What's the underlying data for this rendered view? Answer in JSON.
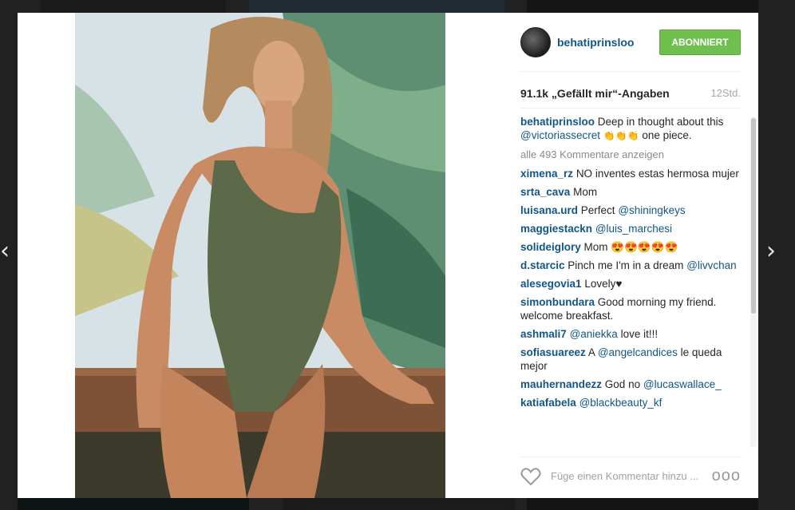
{
  "modal": {
    "username": "behatiprinsloo",
    "follow_label": "ABONNIERT",
    "likes": "91.1k „Gefällt mir“-Angaben",
    "time": "12Std.",
    "caption": {
      "user": "behatiprinsloo",
      "text_before": "Deep in thought about this",
      "mention": "@victoriassecret",
      "emoji": "👏👏👏",
      "text_after": "one piece."
    },
    "load_more": "alle 493 Kommentare anzeigen",
    "comments": [
      {
        "user": "ximena_rz",
        "text": "NO inventes estas hermosa mujer",
        "mention": ""
      },
      {
        "user": "srta_cava",
        "text": "Mom",
        "mention": ""
      },
      {
        "user": "luisana.urd",
        "text": "Perfect",
        "mention": "@shiningkeys"
      },
      {
        "user": "maggiestackn",
        "text": "",
        "mention": "@luis_marchesi"
      },
      {
        "user": "solideiglory",
        "text": "Mom 😍😍😍😍😍",
        "mention": ""
      },
      {
        "user": "d.starcic",
        "text": "Pinch me I'm in a dream",
        "mention": "@livvchan"
      },
      {
        "user": "alesegovia1",
        "text": "Lovely♥",
        "mention": ""
      },
      {
        "user": "simonbundara",
        "text": "Good morning my friend. welcome breakfast.",
        "mention": ""
      },
      {
        "user": "ashmali7",
        "text": "love it!!!",
        "mention": "@aniekka",
        "mention_first": true
      },
      {
        "user": "sofiasuareez",
        "text": "A",
        "mention": "@angelcandices",
        "after": "le queda mejor"
      },
      {
        "user": "mauhernandezz",
        "text": "God no",
        "mention": "@lucaswallace_"
      },
      {
        "user": "katiafabela",
        "text": "",
        "mention": "@blackbeauty_kf"
      }
    ],
    "comment_placeholder": "Füge einen Kommentar hinzu ...",
    "more_label": "ooo"
  },
  "nav": {
    "prev": "‹",
    "next": "›"
  },
  "colors": {
    "link": "#125688",
    "follow_bg": "#70c050",
    "muted": "#a5a7aa"
  },
  "icons": [
    "heart-icon",
    "more-options-icon",
    "chevron-left-icon",
    "chevron-right-icon"
  ]
}
